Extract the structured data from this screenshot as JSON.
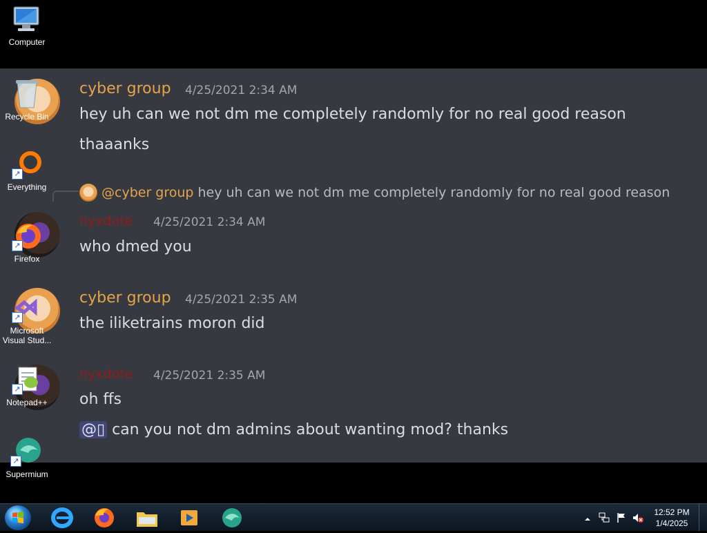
{
  "desktop": {
    "icons": [
      {
        "label": "Computer",
        "icon": "computer-icon"
      },
      {
        "label": "Recycle Bin",
        "icon": "recycle-bin-icon"
      },
      {
        "label": "Everything",
        "icon": "everything-icon"
      },
      {
        "label": "Firefox",
        "icon": "firefox-icon"
      },
      {
        "label": "Microsoft Visual Stud...",
        "icon": "visual-studio-icon"
      },
      {
        "label": "Notepad++",
        "icon": "notepad-plus-plus-icon"
      },
      {
        "label": "Supermium",
        "icon": "supermium-icon"
      }
    ]
  },
  "chat": {
    "messages": [
      {
        "author": "cyber group",
        "timestamp": "4/25/2021 2:34 AM",
        "lines": [
          "hey uh can we not dm me completely randomly for no real good reason",
          "thaaanks"
        ]
      },
      {
        "reply_to_author": "@cyber group",
        "reply_text": "hey uh can we not dm me completely randomly for no real good reason",
        "author": "nyxdote",
        "timestamp": "4/25/2021 2:34 AM",
        "lines": [
          "who dmed you"
        ]
      },
      {
        "author": "cyber group",
        "timestamp": "4/25/2021 2:35 AM",
        "lines": [
          "the iliketrains moron did"
        ]
      },
      {
        "author": "nyxdote",
        "timestamp": "4/25/2021 2:35 AM",
        "lines": [
          "oh ffs"
        ],
        "mention": "@▯",
        "mention_text": "can you not dm admins about wanting mod? thanks"
      }
    ]
  },
  "taskbar": {
    "pinned": [
      "internet-explorer-icon",
      "firefox-icon",
      "file-explorer-icon",
      "media-player-icon",
      "supermium-icon"
    ],
    "tray": [
      "show-hidden-icons-icon",
      "network-icon",
      "action-center-flag-icon",
      "volume-muted-icon"
    ],
    "clock": {
      "time": "12:52 PM",
      "date": "1/4/2025"
    }
  },
  "colors": {
    "chat_bg": "#36393f",
    "cyber_name": "#e7a34a",
    "nyx_name": "#8f1d1d",
    "timestamp": "#a3a6aa",
    "mention_bg": "#414675"
  }
}
